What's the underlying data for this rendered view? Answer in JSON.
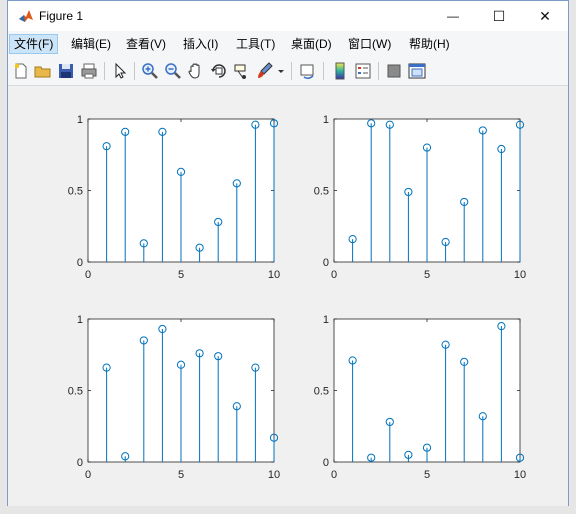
{
  "window": {
    "title": "Figure 1"
  },
  "window_controls": {
    "minimize": "—",
    "maximize": "☐",
    "close": "✕"
  },
  "menu": [
    {
      "label": "文件(F)"
    },
    {
      "label": "编辑(E)"
    },
    {
      "label": "查看(V)"
    },
    {
      "label": "插入(I)"
    },
    {
      "label": "工具(T)"
    },
    {
      "label": "桌面(D)"
    },
    {
      "label": "窗口(W)"
    },
    {
      "label": "帮助(H)"
    }
  ],
  "toolbar_icons": [
    "new-figure-icon",
    "open-file-icon",
    "save-icon",
    "print-icon",
    "pointer-icon",
    "zoom-in-icon",
    "zoom-out-icon",
    "pan-icon",
    "rotate-3d-icon",
    "data-cursor-icon",
    "brush-icon",
    "brush-dropdown-icon",
    "link-plot-icon",
    "colorbar-icon",
    "legend-icon",
    "hide-plot-tools-icon",
    "show-plot-tools-icon"
  ],
  "colors": {
    "stem": "#0072bd",
    "axes_bg": "#ffffff",
    "figure_bg": "#f0f0f0",
    "axis": "#262626"
  },
  "chart_data": [
    {
      "type": "stem",
      "x": [
        1,
        2,
        3,
        4,
        5,
        6,
        7,
        8,
        9,
        10
      ],
      "values": [
        0.81,
        0.91,
        0.13,
        0.91,
        0.63,
        0.1,
        0.28,
        0.55,
        0.96,
        0.97
      ],
      "xlim": [
        0,
        10
      ],
      "ylim": [
        0,
        1
      ],
      "xticks": [
        "0",
        "5",
        "10"
      ],
      "yticks": [
        "0",
        "0.5",
        "1"
      ]
    },
    {
      "type": "stem",
      "x": [
        1,
        2,
        3,
        4,
        5,
        6,
        7,
        8,
        9,
        10
      ],
      "values": [
        0.16,
        0.97,
        0.96,
        0.49,
        0.8,
        0.14,
        0.42,
        0.92,
        0.79,
        0.96
      ],
      "xlim": [
        0,
        10
      ],
      "ylim": [
        0,
        1
      ],
      "xticks": [
        "0",
        "5",
        "10"
      ],
      "yticks": [
        "0",
        "0.5",
        "1"
      ]
    },
    {
      "type": "stem",
      "x": [
        1,
        2,
        3,
        4,
        5,
        6,
        7,
        8,
        9,
        10
      ],
      "values": [
        0.66,
        0.04,
        0.85,
        0.93,
        0.68,
        0.76,
        0.74,
        0.39,
        0.66,
        0.17
      ],
      "xlim": [
        0,
        10
      ],
      "ylim": [
        0,
        1
      ],
      "xticks": [
        "0",
        "5",
        "10"
      ],
      "yticks": [
        "0",
        "0.5",
        "1"
      ]
    },
    {
      "type": "stem",
      "x": [
        1,
        2,
        3,
        4,
        5,
        6,
        7,
        8,
        9,
        10
      ],
      "values": [
        0.71,
        0.03,
        0.28,
        0.05,
        0.1,
        0.82,
        0.7,
        0.32,
        0.95,
        0.03
      ],
      "xlim": [
        0,
        10
      ],
      "ylim": [
        0,
        1
      ],
      "xticks": [
        "0",
        "5",
        "10"
      ],
      "yticks": [
        "0",
        "0.5",
        "1"
      ]
    }
  ]
}
